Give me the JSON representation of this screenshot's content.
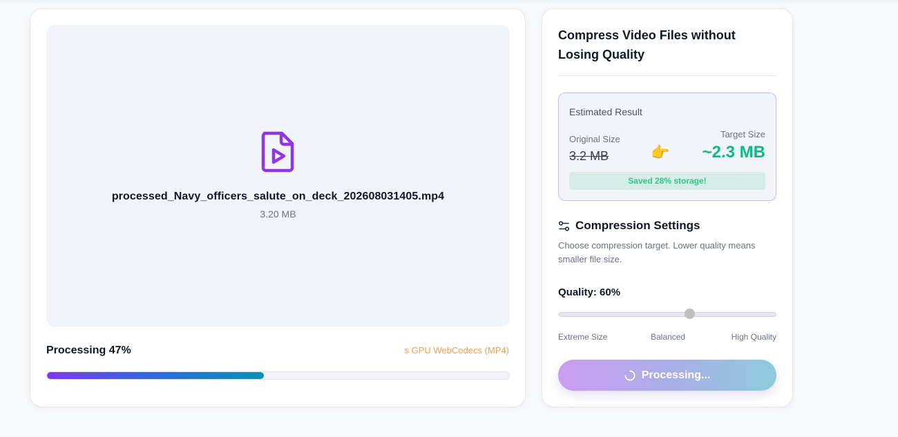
{
  "file": {
    "name": "processed_Navy_officers_salute_on_deck_202608031405.mp4",
    "size": "3.20 MB",
    "icon": "file-video-icon"
  },
  "progress": {
    "label": "Processing 47%",
    "percent": 47,
    "engine": "s GPU WebCodecs (MP4)"
  },
  "sidebar": {
    "title": "Compress Video Files without Losing Quality",
    "estimate": {
      "heading": "Estimated Result",
      "original_label": "Original Size",
      "original_value": "3.2 MB",
      "target_label": "Target Size",
      "target_value": "~2.3 MB",
      "saved_text": "Saved 28% storage!",
      "pointer_icon": "pointing-hand-icon"
    },
    "settings": {
      "title": "Compression Settings",
      "icon": "sliders-icon",
      "description": "Choose compression target. Lower quality means smaller file size.",
      "quality_label": "Quality: 60%",
      "quality_value": 60,
      "ticks": [
        "Extreme Size",
        "Balanced",
        "High Quality"
      ]
    },
    "button_label": "Processing..."
  },
  "colors": {
    "accent": "#7c3aed",
    "success": "#10b981",
    "engine_text": "#f0a050"
  }
}
